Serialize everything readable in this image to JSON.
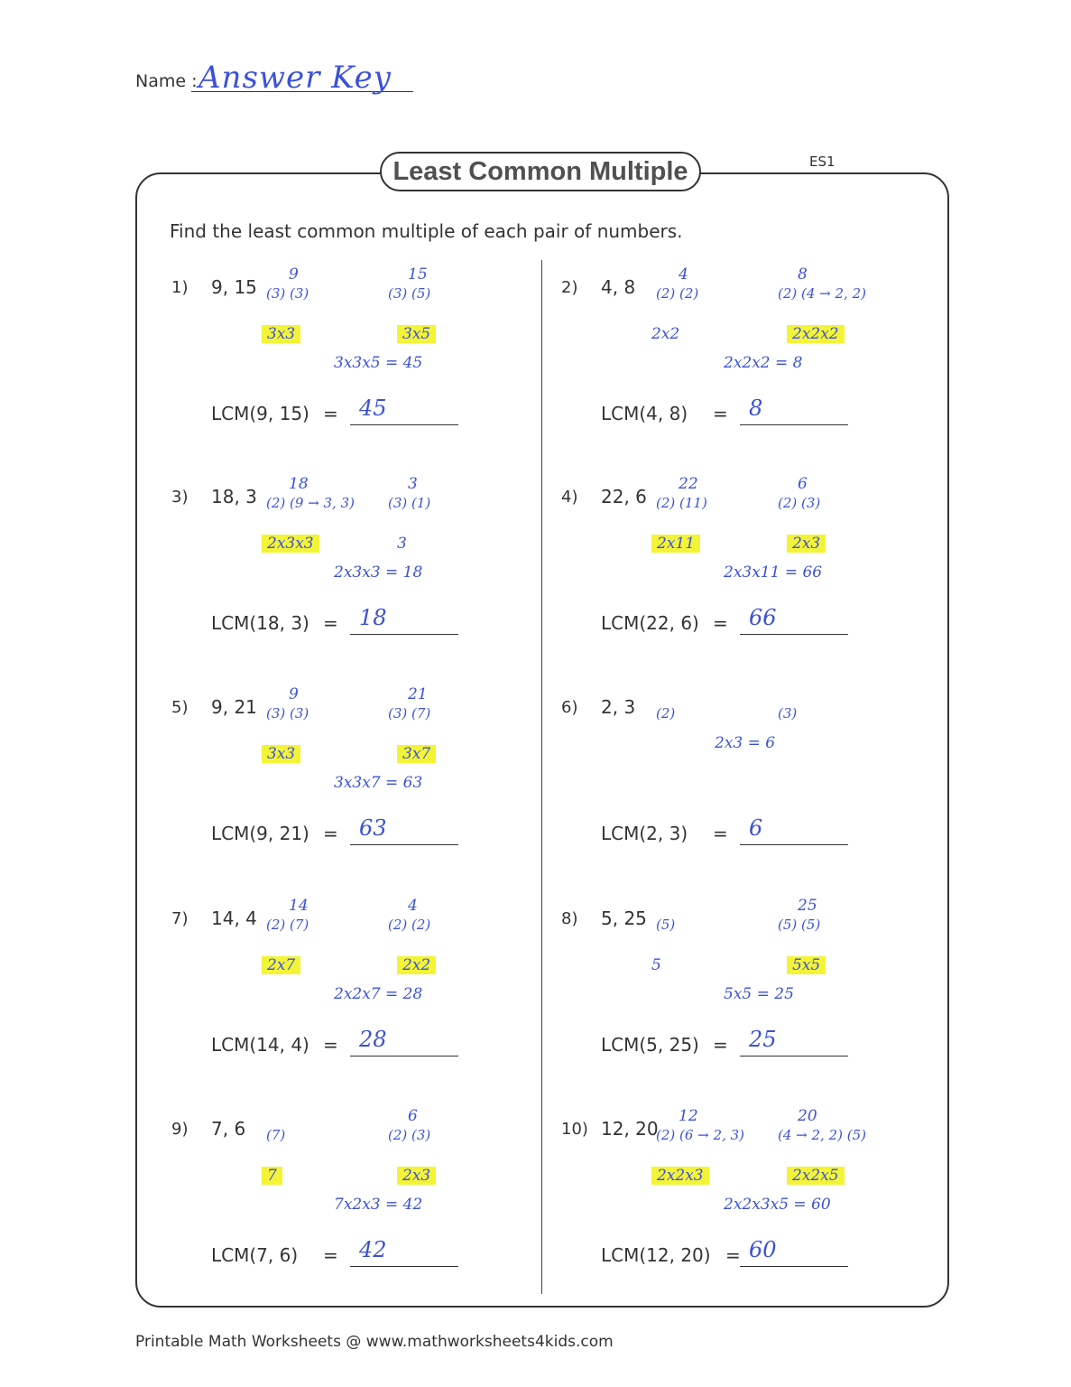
{
  "header": {
    "name_label": "Name :",
    "name_value": "Answer Key",
    "title": "Least Common Multiple",
    "sheet_code": "ES1",
    "instructions": "Find the least common multiple of each pair of numbers."
  },
  "problems": [
    {
      "num": "1)",
      "pair": "9, 15",
      "lcm_label": "LCM(9, 15)",
      "eq": "=",
      "answer": "45",
      "tree_a": {
        "root": "9",
        "factors": [
          "3",
          "3"
        ]
      },
      "tree_b": {
        "root": "15",
        "factors": [
          "3",
          "5"
        ]
      },
      "prod_a": "3x3",
      "prod_b": "3x5",
      "work": "3x3x5 = 45"
    },
    {
      "num": "2)",
      "pair": "4, 8",
      "lcm_label": "LCM(4, 8)",
      "eq": "=",
      "answer": "8",
      "tree_a": {
        "root": "4",
        "factors": [
          "2",
          "2"
        ]
      },
      "tree_b": {
        "root": "8",
        "factors": [
          "2",
          "4 → 2, 2"
        ]
      },
      "prod_a": "2x2",
      "prod_b": "2x2x2",
      "work": "2x2x2 = 8"
    },
    {
      "num": "3)",
      "pair": "18, 3",
      "lcm_label": "LCM(18, 3)",
      "eq": "=",
      "answer": "18",
      "tree_a": {
        "root": "18",
        "factors": [
          "2",
          "9 → 3, 3"
        ]
      },
      "tree_b": {
        "root": "3",
        "factors": [
          "3",
          "1"
        ]
      },
      "prod_a": "2x3x3",
      "prod_b": "3",
      "work": "2x3x3 = 18"
    },
    {
      "num": "4)",
      "pair": "22, 6",
      "lcm_label": "LCM(22, 6)",
      "eq": "=",
      "answer": "66",
      "tree_a": {
        "root": "22",
        "factors": [
          "2",
          "11"
        ]
      },
      "tree_b": {
        "root": "6",
        "factors": [
          "2",
          "3"
        ]
      },
      "prod_a": "2x11",
      "prod_b": "2x3",
      "work": "2x3x11 = 66"
    },
    {
      "num": "5)",
      "pair": "9, 21",
      "lcm_label": "LCM(9, 21)",
      "eq": "=",
      "answer": "63",
      "tree_a": {
        "root": "9",
        "factors": [
          "3",
          "3"
        ]
      },
      "tree_b": {
        "root": "21",
        "factors": [
          "3",
          "7"
        ]
      },
      "prod_a": "3x3",
      "prod_b": "3x7",
      "work": "3x3x7 = 63"
    },
    {
      "num": "6)",
      "pair": "2, 3",
      "lcm_label": "LCM(2, 3)",
      "eq": "=",
      "answer": "6",
      "tree_a": {
        "root": "",
        "factors": [
          "2"
        ]
      },
      "tree_b": {
        "root": "",
        "factors": [
          "3"
        ]
      },
      "prod_a": "",
      "prod_b": "",
      "work": "2x3 = 6"
    },
    {
      "num": "7)",
      "pair": "14, 4",
      "lcm_label": "LCM(14, 4)",
      "eq": "=",
      "answer": "28",
      "tree_a": {
        "root": "14",
        "factors": [
          "2",
          "7"
        ]
      },
      "tree_b": {
        "root": "4",
        "factors": [
          "2",
          "2"
        ]
      },
      "prod_a": "2x7",
      "prod_b": "2x2",
      "work": "2x2x7 = 28"
    },
    {
      "num": "8)",
      "pair": "5, 25",
      "lcm_label": "LCM(5, 25)",
      "eq": "=",
      "answer": "25",
      "tree_a": {
        "root": "",
        "factors": [
          "5"
        ]
      },
      "tree_b": {
        "root": "25",
        "factors": [
          "5",
          "5"
        ]
      },
      "prod_a": "5",
      "prod_b": "5x5",
      "work": "5x5 = 25"
    },
    {
      "num": "9)",
      "pair": "7, 6",
      "lcm_label": "LCM(7, 6)",
      "eq": "=",
      "answer": "42",
      "tree_a": {
        "root": "",
        "factors": [
          "7"
        ]
      },
      "tree_b": {
        "root": "6",
        "factors": [
          "2",
          "3"
        ]
      },
      "prod_a": "7",
      "prod_b": "2x3",
      "work": "7x2x3 = 42"
    },
    {
      "num": "10)",
      "pair": "12, 20",
      "lcm_label": "LCM(12, 20)",
      "eq": "=",
      "answer": "60",
      "tree_a": {
        "root": "12",
        "factors": [
          "2",
          "6 → 2, 3"
        ]
      },
      "tree_b": {
        "root": "20",
        "factors": [
          "4 → 2, 2",
          "5"
        ]
      },
      "prod_a": "2x2x3",
      "prod_b": "2x2x5",
      "work": "2x2x3x5 = 60"
    }
  ],
  "footer": {
    "text": "Printable Math Worksheets @ www.mathworksheets4kids.com"
  },
  "colors": {
    "ink": "#3b52d6",
    "highlight": "#f4f437",
    "print": "#333333"
  }
}
